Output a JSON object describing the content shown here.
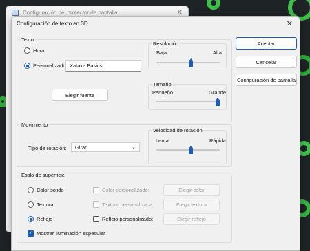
{
  "background_window": {
    "title": "Configuración del protector de pantalla"
  },
  "dialog": {
    "title": "Configuración de texto en 3D",
    "close_glyph": "✕"
  },
  "texto": {
    "legend": "Texto",
    "option_hora": "Hora",
    "option_personalizado": "Personalizado:",
    "personalizado_value": "Xataka Basics",
    "elegir_fuente": "Elegir fuente",
    "selected": "personalizado"
  },
  "resolucion": {
    "legend": "Resolución",
    "low_label": "Baja",
    "high_label": "Alta",
    "value_fraction": 0.55
  },
  "tamano": {
    "legend": "Tamaño",
    "low_label": "Pequeño",
    "high_label": "Grande",
    "value_fraction": 1.0
  },
  "movimiento": {
    "legend": "Movimiento",
    "tipo_label": "Tipo de rotación:",
    "tipo_value": "Girar"
  },
  "velocidad": {
    "legend": "Velocidad de rotación",
    "low_label": "Lenta",
    "high_label": "Rápida",
    "value_fraction": 0.55
  },
  "estilo": {
    "legend": "Estilo de superficie",
    "options": {
      "color_solido": "Color sólido",
      "textura": "Textura",
      "reflejo": "Reflejo"
    },
    "selected": "reflejo",
    "checks": {
      "color_personalizado": "Color personalizado:",
      "textura_personalizada": "Textura personalizada:",
      "reflejo_personalizado": "Reflejo personalizado:"
    },
    "buttons": {
      "elegir_color": "Elegir color",
      "elegir_textura": "Elegir textura",
      "elegir_reflejo": "Elegir reflejo"
    },
    "mostrar_iluminacion": "Mostrar iluminación especular",
    "mostrar_iluminacion_checked": true
  },
  "actions": {
    "aceptar": "Aceptar",
    "cancelar": "Cancelar",
    "config_pantalla": "Configuración de pantalla"
  },
  "colors": {
    "accent": "#1a5fb4",
    "dialog_bg": "#f0f0f0",
    "backdrop": "#1e2326",
    "backdrop_accent": "#3fc04a"
  }
}
